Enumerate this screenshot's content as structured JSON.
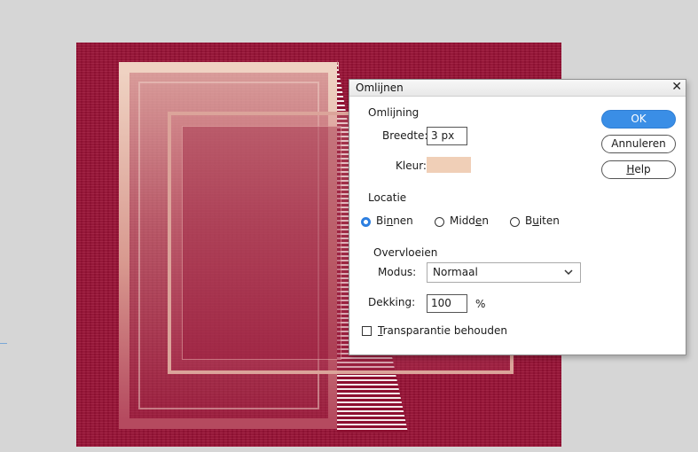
{
  "dialog": {
    "title": "Omlijnen",
    "close_glyph": "✕",
    "stroke_section": "Omlijning",
    "width_label": "Breedte:",
    "width_value": "3 px",
    "color_label": "Kleur:",
    "color_value": "#f0cfb7",
    "location_section": "Locatie",
    "location_options": [
      {
        "pre": "Bi",
        "mnemonic": "n",
        "post": "nen",
        "checked": true
      },
      {
        "pre": "Midd",
        "mnemonic": "e",
        "post": "n",
        "checked": false
      },
      {
        "pre": "B",
        "mnemonic": "u",
        "post": "iten",
        "checked": false
      }
    ],
    "blend_section": "Overvloeien",
    "mode_label": "Modus:",
    "mode_value": "Normaal",
    "opacity_label": "Dekking:",
    "opacity_value": "100",
    "opacity_unit": "%",
    "preserve_mnemonic": "T",
    "preserve_rest": "ransparantie behouden",
    "preserve_checked": false,
    "ok_label": "OK",
    "cancel_label": "Annuleren",
    "help_mnemonic": "H",
    "help_rest": "elp"
  },
  "colors": {
    "canvas": "#9a1236",
    "frame": "#e7bfaf",
    "accent": "#3a8ee6",
    "stroke_color": "#f0cfb7"
  }
}
